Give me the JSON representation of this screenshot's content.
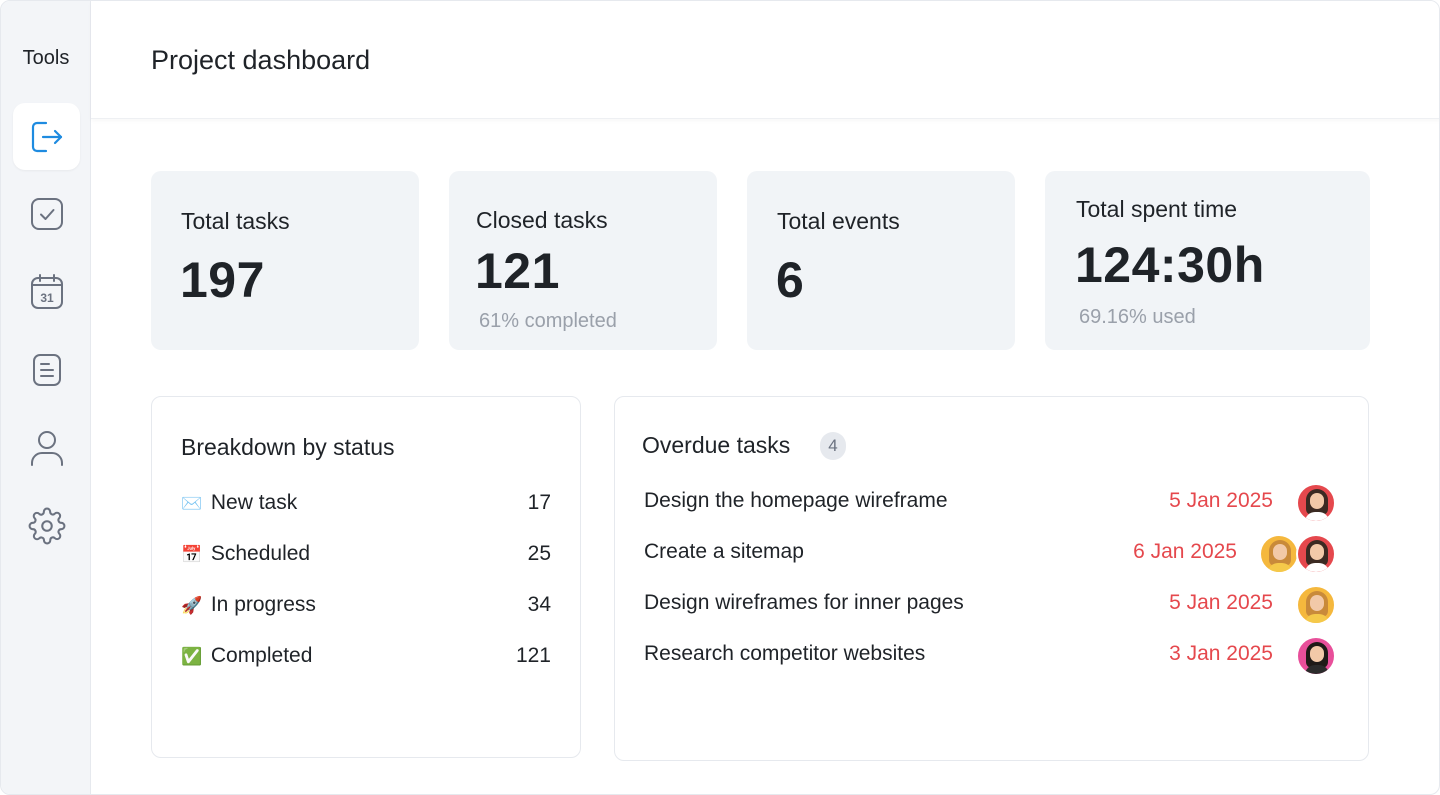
{
  "sidebar": {
    "title": "Tools",
    "items": [
      {
        "icon": "logout-icon",
        "active": true
      },
      {
        "icon": "checkbox-icon",
        "active": false
      },
      {
        "icon": "calendar-icon",
        "active": false,
        "label": "31"
      },
      {
        "icon": "document-icon",
        "active": false
      },
      {
        "icon": "user-icon",
        "active": false
      },
      {
        "icon": "gear-icon",
        "active": false
      }
    ],
    "accent": "#1e8be0",
    "icon_color": "#6b7280"
  },
  "header": {
    "title": "Project dashboard"
  },
  "stats": [
    {
      "label": "Total tasks",
      "value": "197"
    },
    {
      "label": "Closed tasks",
      "value": "121",
      "sub": "61% completed"
    },
    {
      "label": "Total events",
      "value": "6"
    },
    {
      "label": "Total spent time",
      "value": "124:30h",
      "sub": "69.16% used"
    }
  ],
  "breakdown": {
    "title": "Breakdown by status",
    "rows": [
      {
        "emoji": "✉️",
        "label": "New task",
        "count": "17"
      },
      {
        "emoji": "📅",
        "label": "Scheduled",
        "count": "25"
      },
      {
        "emoji": "🚀",
        "label": "In progress",
        "count": "34"
      },
      {
        "emoji": "✅",
        "label": "Completed",
        "count": "121"
      }
    ]
  },
  "overdue": {
    "title": "Overdue tasks",
    "count": "4",
    "date_color": "#e5484d",
    "tasks": [
      {
        "title": "Design the homepage wireframe",
        "date": "5 Jan 2025",
        "assignees": [
          "red"
        ]
      },
      {
        "title": "Create a sitemap",
        "date": "6 Jan 2025",
        "assignees": [
          "yellow",
          "red"
        ]
      },
      {
        "title": "Design wireframes for inner pages",
        "date": "5 Jan 2025",
        "assignees": [
          "yellow"
        ]
      },
      {
        "title": "Research competitor websites",
        "date": "3 Jan 2025",
        "assignees": [
          "pink"
        ]
      }
    ],
    "avatar_colors": {
      "red": "#e5484d",
      "yellow": "#f5b83d",
      "pink": "#e84f9a"
    }
  }
}
